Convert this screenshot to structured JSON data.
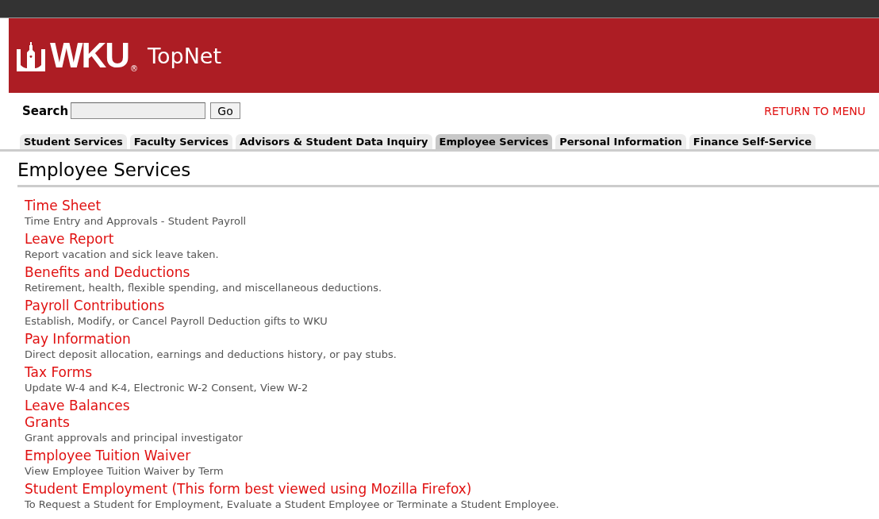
{
  "header": {
    "logo_text": "WKU",
    "registered_mark": "®",
    "app_name": "TopNet"
  },
  "search": {
    "label": "Search",
    "button": "Go"
  },
  "return_link": "RETURN TO MENU",
  "tabs": [
    {
      "label": "Student Services",
      "selected": false
    },
    {
      "label": "Faculty Services",
      "selected": false
    },
    {
      "label": "Advisors & Student Data Inquiry",
      "selected": false
    },
    {
      "label": "Employee Services",
      "selected": true
    },
    {
      "label": "Personal Information",
      "selected": false
    },
    {
      "label": "Finance Self-Service",
      "selected": false
    }
  ],
  "page_title": "Employee Services",
  "menu": [
    {
      "title": "Time Sheet",
      "description": "Time Entry and Approvals - Student Payroll"
    },
    {
      "title": "Leave Report",
      "description": "Report vacation and sick leave taken."
    },
    {
      "title": "Benefits and Deductions",
      "description": "Retirement, health, flexible spending, and miscellaneous deductions."
    },
    {
      "title": "Payroll Contributions",
      "description": "Establish, Modify, or Cancel Payroll Deduction gifts to WKU"
    },
    {
      "title": "Pay Information",
      "description": "Direct deposit allocation, earnings and deductions history, or pay stubs."
    },
    {
      "title": "Tax Forms",
      "description": "Update W-4 and K-4, Electronic W-2 Consent, View W-2"
    },
    {
      "title": "Leave Balances"
    },
    {
      "title": "Grants",
      "description": "Grant approvals and principal investigator"
    },
    {
      "title": "Employee Tuition Waiver",
      "description": "View Employee Tuition Waiver by Term"
    },
    {
      "title": "Student Employment (This form best viewed using Mozilla Firefox)",
      "description": "To Request a Student for Employment, Evaluate a Student Employee or Terminate a Student Employee."
    }
  ]
}
